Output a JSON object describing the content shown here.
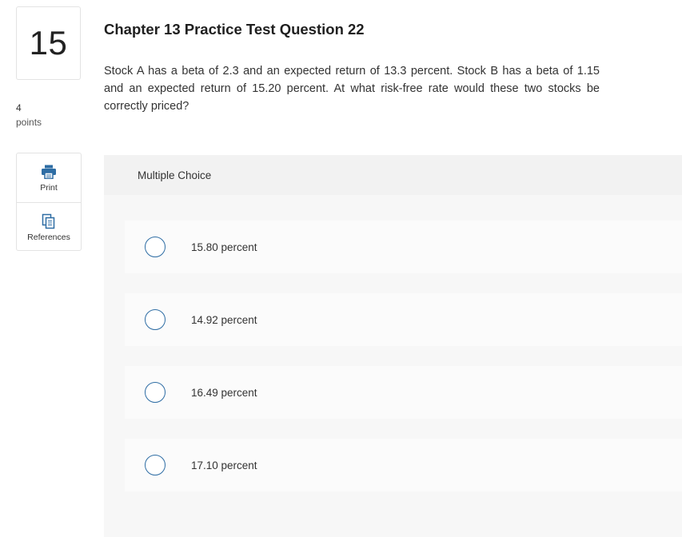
{
  "question": {
    "number": "15",
    "points_value": "4",
    "points_label": "points",
    "title": "Chapter 13 Practice Test Question 22",
    "stem": "Stock A has a beta of 2.3 and an expected return of 13.3 percent. Stock B has a beta of 1.15 and an expected return of 15.20 percent. At what risk-free rate would these two stocks be correctly priced?"
  },
  "tools": {
    "print_label": "Print",
    "references_label": "References",
    "print_icon": "printer-icon",
    "references_icon": "documents-icon",
    "icon_color": "#2e6da4"
  },
  "answer": {
    "type_label": "Multiple Choice",
    "choices": [
      {
        "label": "15.80 percent"
      },
      {
        "label": "14.92 percent"
      },
      {
        "label": "16.49 percent"
      },
      {
        "label": "17.10 percent"
      }
    ]
  }
}
